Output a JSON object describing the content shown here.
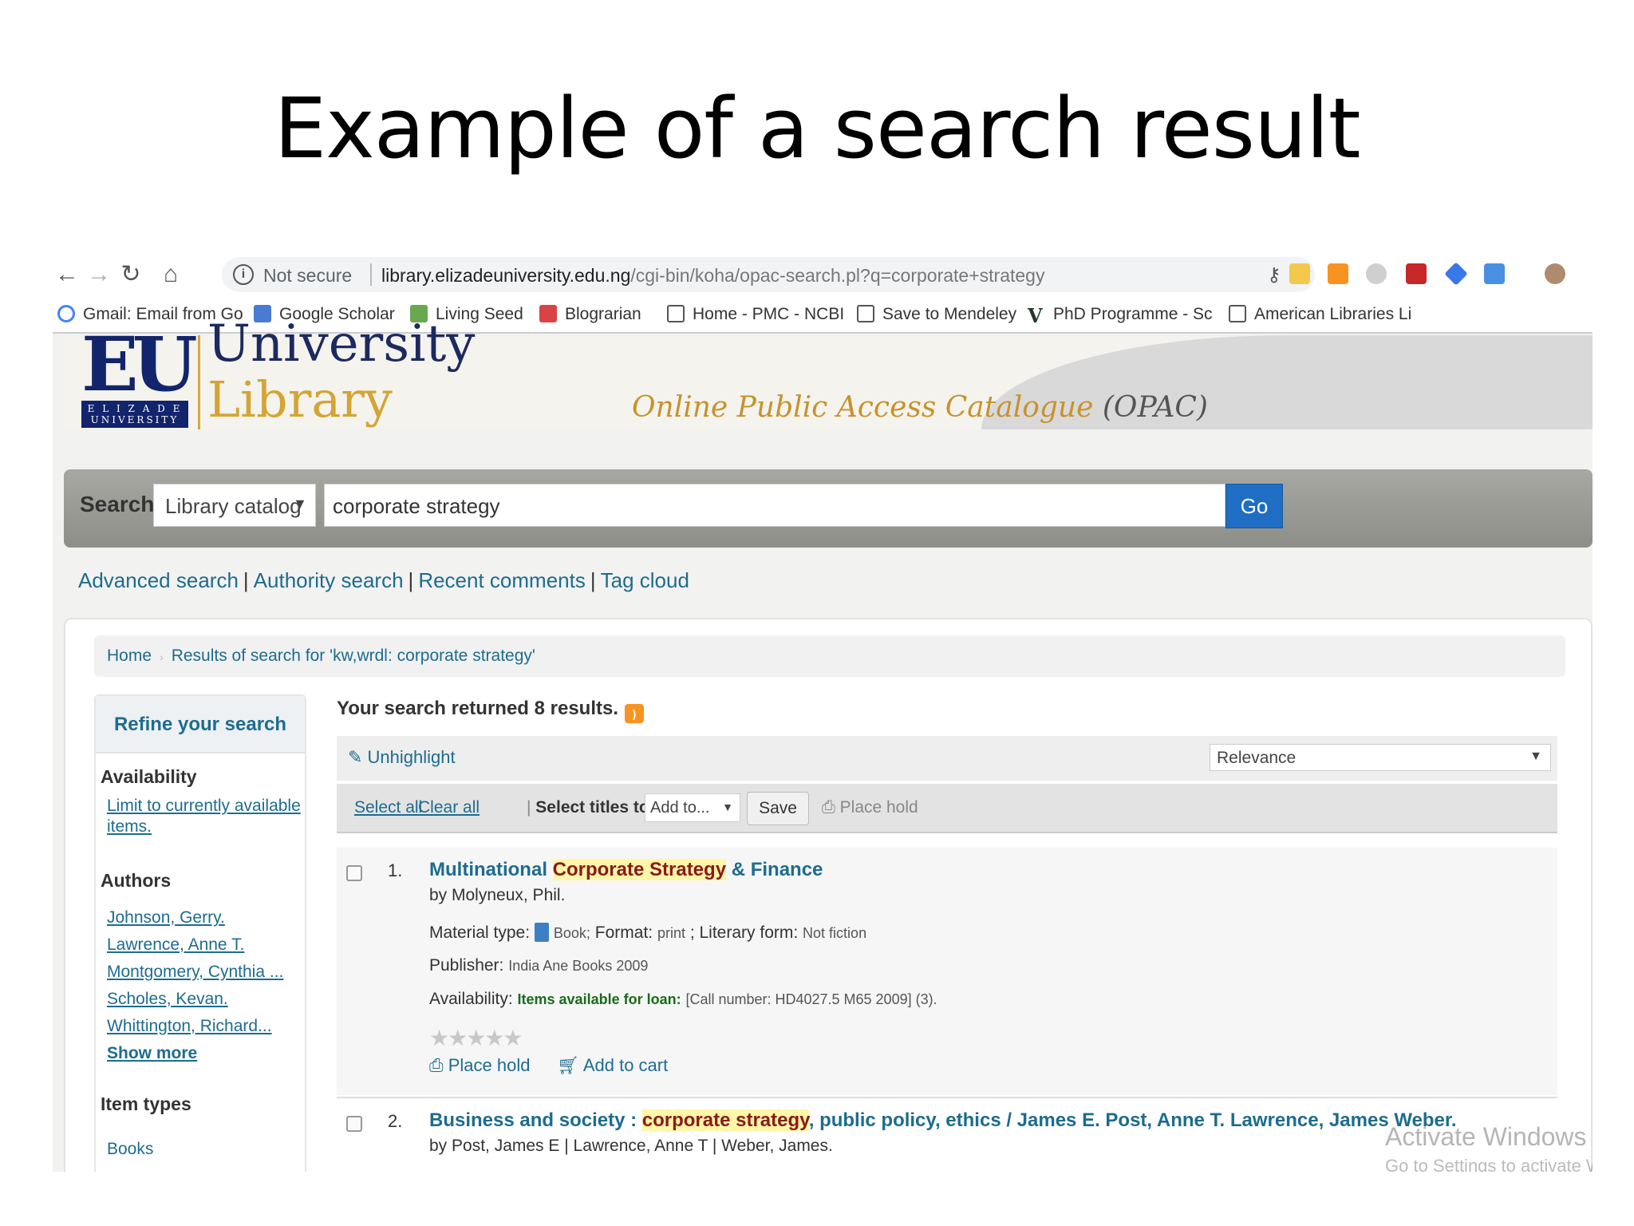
{
  "slide": {
    "title": "Example of a search result"
  },
  "browser": {
    "not_secure": "Not secure",
    "url_host": "library.elizadeuniversity.edu.ng",
    "url_path": "/cgi-bin/koha/opac-search.pl?q=corporate+strategy",
    "bookmarks": [
      {
        "label": "Gmail: Email from Go",
        "icon": "google-icon",
        "color": "#4285f4"
      },
      {
        "label": "Google Scholar",
        "icon": "scholar-icon",
        "color": "#4a7bd0"
      },
      {
        "label": "Living Seed",
        "icon": "living-seed-icon",
        "color": "#6aa84f"
      },
      {
        "label": "Blograrian",
        "icon": "blogger-icon",
        "color": "#d94343"
      },
      {
        "label": "Home - PMC - NCBI",
        "icon": "ncbi-icon",
        "color": "#555555"
      },
      {
        "label": "Save to Mendeley",
        "icon": "page-icon",
        "color": "#ffffff"
      },
      {
        "label": "PhD Programme - Sc",
        "icon": "v-icon",
        "color": "#1f3b2a"
      },
      {
        "label": "American Libraries Li",
        "icon": "page-icon",
        "color": "#ffffff"
      }
    ]
  },
  "header": {
    "logo_text": "EU",
    "logo_plate": "E L I Z A D E UNIVERSITY",
    "university": "University",
    "library": "Library",
    "opac_text": "Online Public Access Catalogue",
    "opac_abbr": "(OPAC)"
  },
  "search": {
    "label": "Search",
    "scope": "Library catalog",
    "query": "corporate strategy",
    "go": "Go"
  },
  "links": [
    "Advanced search",
    "Authority search",
    "Recent comments",
    "Tag cloud"
  ],
  "breadcrumb": {
    "home": "Home",
    "current": "Results of search for 'kw,wrdl: corporate strategy'"
  },
  "refine": {
    "heading": "Refine your search",
    "availability_heading": "Availability",
    "availability_link_1": "Limit to currently available",
    "availability_link_2": "items.",
    "authors_heading": "Authors",
    "authors": [
      "Johnson, Gerry.",
      "Lawrence, Anne T.",
      "Montgomery, Cynthia ...",
      "Scholes, Kevan.",
      "Whittington, Richard..."
    ],
    "show_more": "Show more",
    "item_types_heading": "Item types",
    "item_types": [
      "Books"
    ]
  },
  "results": {
    "count_text": "Your search returned 8 results.",
    "unhighlight": "Unhighlight",
    "sort": "Relevance",
    "select_all": "Select all",
    "clear_all": "Clear all",
    "select_titles": "Select titles to:",
    "add_to": "Add to...",
    "save": "Save",
    "place_hold": "Place hold",
    "records": [
      {
        "number": "1.",
        "title_pre": "Multinational ",
        "title_hl": "Corporate Strategy",
        "title_post": " & Finance",
        "author": "by Molyneux, Phil.",
        "material_label": "Material type:",
        "material": "Book;",
        "format_label": "Format:",
        "format": "print",
        "literary_label": "; Literary form:",
        "literary": "Not fiction",
        "publisher_label": "Publisher:",
        "publisher": "India Ane Books 2009",
        "availability_label": "Availability:",
        "availability_status": "Items available for loan:",
        "availability_call": "[Call number: HD4027.5 M65 2009] (3).",
        "rating": 0,
        "place_hold": "Place hold",
        "add_to_cart": "Add to cart"
      },
      {
        "number": "2.",
        "title_pre": "Business and society : ",
        "title_hl": "corporate strategy",
        "title_post": ", public policy, ethics / James E. Post, Anne T. Lawrence, James Weber.",
        "author": "by Post, James E | Lawrence, Anne T | Weber, James."
      }
    ]
  },
  "watermark": {
    "title": "Activate Windows",
    "subtitle": "Go to Settings to activate Windows."
  }
}
